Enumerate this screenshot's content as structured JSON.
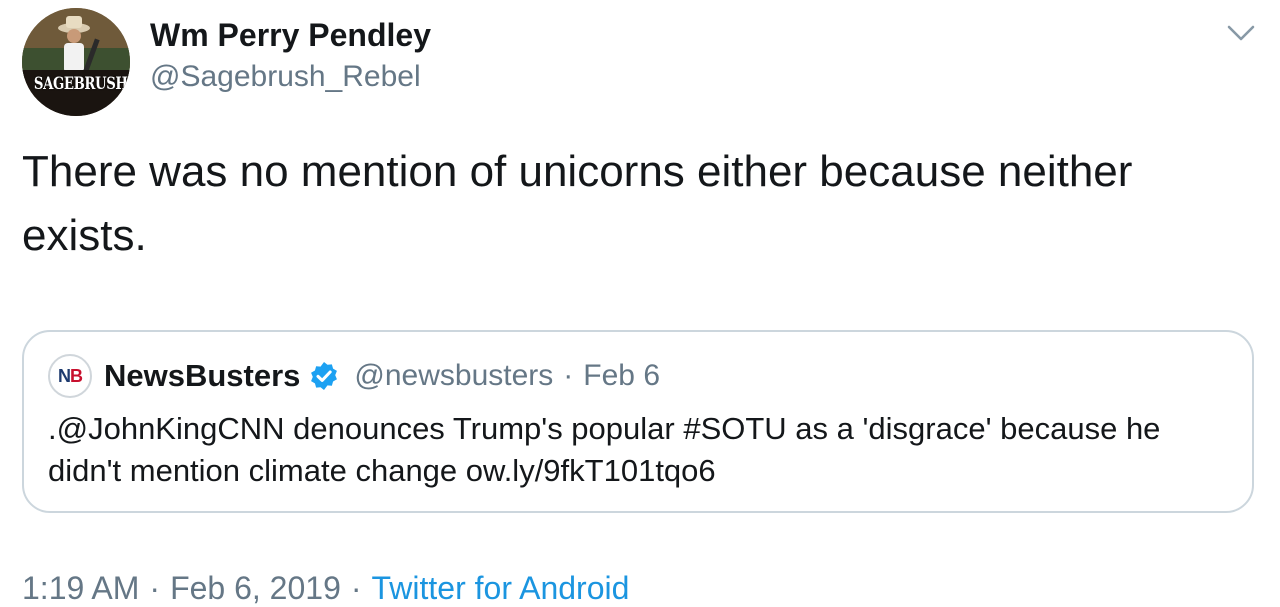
{
  "author": {
    "name": "Wm Perry Pendley",
    "handle": "@Sagebrush_Rebel",
    "avatar_text": "SAGEBRUSH"
  },
  "tweet": {
    "text": "There was no mention of unicorns either because neither exists."
  },
  "quoted_tweet": {
    "logo_text_a": "N",
    "logo_text_b": "B",
    "name": "NewsBusters",
    "verified": true,
    "handle": "@newsbusters",
    "separator": "·",
    "date": "Feb 6",
    "text": ".@JohnKingCNN denounces Trump's popular #SOTU as a 'disgrace' because he didn't mention climate change ow.ly/9fkT101tqo6"
  },
  "meta": {
    "time": "1:19 AM",
    "separator": "·",
    "date": "Feb 6, 2019",
    "source": "Twitter for Android"
  },
  "icons": {
    "caret": "chevron-down-icon",
    "verified": "verified-badge-icon"
  },
  "colors": {
    "link": "#1b95e0",
    "secondary_text": "#657786",
    "primary_text": "#14171a",
    "verified": "#1da1f2",
    "border": "#ccd6dd"
  }
}
